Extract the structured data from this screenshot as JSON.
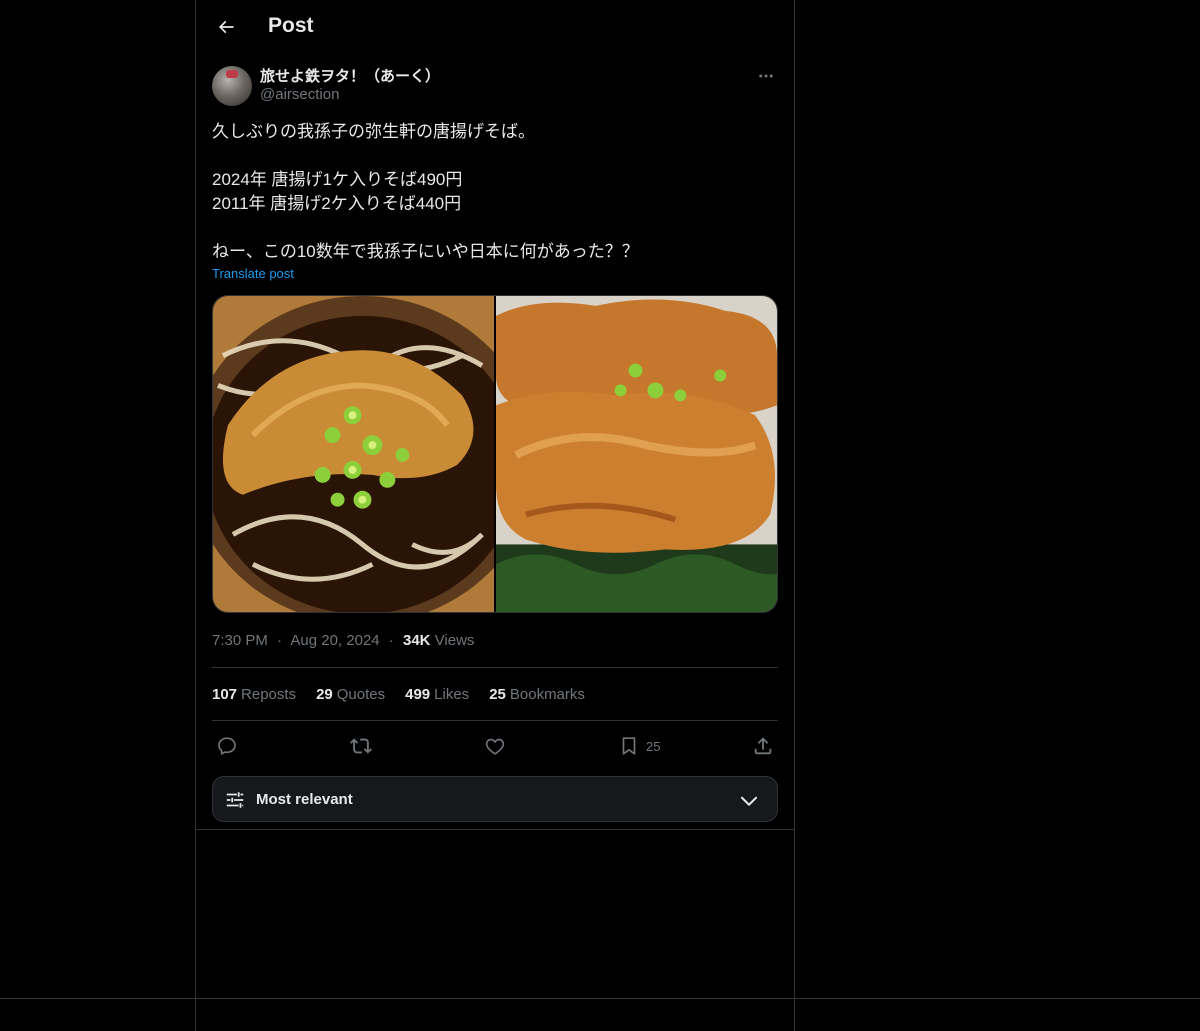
{
  "header": {
    "title": "Post"
  },
  "author": {
    "display_name": "旅せよ鉄ヲタ！（あーく）",
    "handle": "@airsection"
  },
  "post": {
    "lines": [
      "久しぶりの我孫子の弥生軒の唐揚げそば。",
      "",
      "2024年 唐揚げ1ケ入りそば490円",
      "2011年 唐揚げ2ケ入りそば440円",
      "",
      "ねー、この10数年で我孫子にいや日本に何があった？？"
    ],
    "translate_label": "Translate post",
    "time": "7:30 PM",
    "date": "Aug 20, 2024",
    "views_count": "34K",
    "views_label": "Views",
    "separator": "·"
  },
  "stats": {
    "reposts": {
      "count": "107",
      "label": "Reposts"
    },
    "quotes": {
      "count": "29",
      "label": "Quotes"
    },
    "likes": {
      "count": "499",
      "label": "Likes"
    },
    "bookmarks": {
      "count": "25",
      "label": "Bookmarks"
    }
  },
  "actions": {
    "bookmark_count": "25",
    "icons": [
      "reply-icon",
      "repost-icon",
      "like-icon",
      "bookmark-icon",
      "share-icon"
    ]
  },
  "sort": {
    "label": "Most relevant"
  },
  "colors": {
    "background": "#000000",
    "text": "#e7e9ea",
    "secondary": "#71767b",
    "accent": "#1d9bf0",
    "border": "#2f3336"
  }
}
